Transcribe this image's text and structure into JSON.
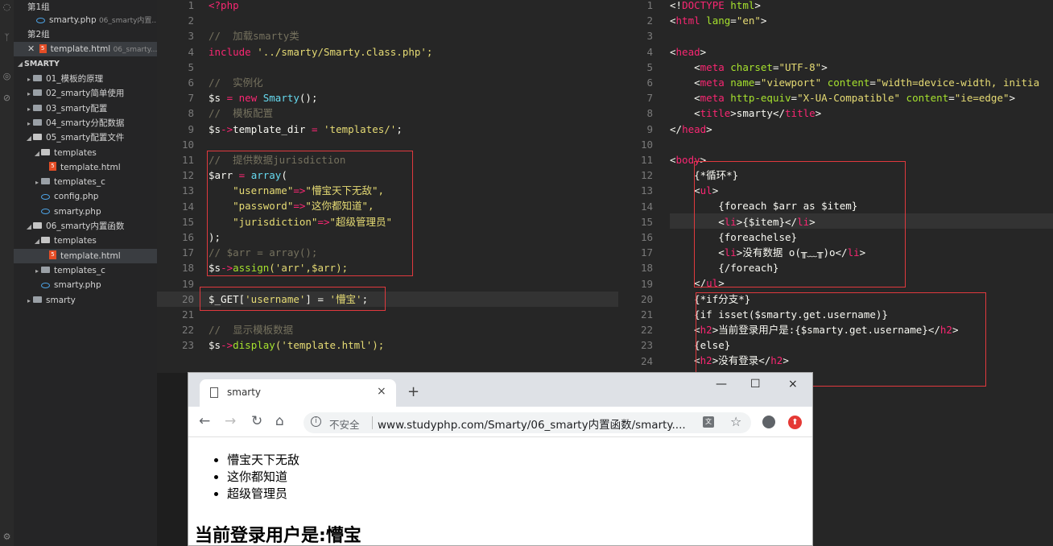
{
  "sidebar": {
    "groups": [
      {
        "label": "第1组"
      },
      {
        "label": "第2组"
      }
    ],
    "open_files": [
      {
        "name": "smarty.php",
        "path": "06_smarty内置..."
      },
      {
        "name": "template.html",
        "path": "06_smarty..."
      }
    ],
    "project": "SMARTY",
    "tree": [
      {
        "label": "01_模板的原理",
        "level": 1,
        "kind": "folder",
        "open": false
      },
      {
        "label": "02_smarty简单使用",
        "level": 1,
        "kind": "folder",
        "open": false
      },
      {
        "label": "03_smarty配置",
        "level": 1,
        "kind": "folder",
        "open": false
      },
      {
        "label": "04_smarty分配数据",
        "level": 1,
        "kind": "folder",
        "open": false
      },
      {
        "label": "05_smarty配置文件",
        "level": 1,
        "kind": "folder",
        "open": true
      },
      {
        "label": "templates",
        "level": 2,
        "kind": "folder",
        "open": true
      },
      {
        "label": "template.html",
        "level": 3,
        "kind": "html"
      },
      {
        "label": "templates_c",
        "level": 2,
        "kind": "folder",
        "open": false
      },
      {
        "label": "config.php",
        "level": 2,
        "kind": "php"
      },
      {
        "label": "smarty.php",
        "level": 2,
        "kind": "php"
      },
      {
        "label": "06_smarty内置函数",
        "level": 1,
        "kind": "folder",
        "open": true
      },
      {
        "label": "templates",
        "level": 2,
        "kind": "folder",
        "open": true
      },
      {
        "label": "template.html",
        "level": 3,
        "kind": "html",
        "selected": true
      },
      {
        "label": "templates_c",
        "level": 2,
        "kind": "folder",
        "open": false
      },
      {
        "label": "smarty.php",
        "level": 2,
        "kind": "php"
      },
      {
        "label": "smarty",
        "level": 1,
        "kind": "folder",
        "open": false
      }
    ]
  },
  "editor_left": {
    "lines": [
      [
        [
          "<?php",
          "#f92672"
        ]
      ],
      [],
      [
        [
          "//  加载smarty类",
          "#75715e"
        ]
      ],
      [
        [
          "include",
          "#f92672"
        ],
        [
          " '../smarty/Smarty.class.php';",
          "#e6db74"
        ]
      ],
      [],
      [
        [
          "//  实例化",
          "#75715e"
        ]
      ],
      [
        [
          "$s",
          "#f8f8f2"
        ],
        [
          " = ",
          "#f92672"
        ],
        [
          "new",
          "#f92672"
        ],
        [
          " Smarty",
          "#66d9ef"
        ],
        [
          "();",
          "#f8f8f2"
        ]
      ],
      [
        [
          "//  模板配置",
          "#75715e"
        ]
      ],
      [
        [
          "$s",
          "#f8f8f2"
        ],
        [
          "->",
          "#f92672"
        ],
        [
          "template_dir",
          "#f8f8f2"
        ],
        [
          " = ",
          "#f92672"
        ],
        [
          "'templates/'",
          "#e6db74"
        ],
        [
          ";",
          "#f8f8f2"
        ]
      ],
      [],
      [
        [
          "//  提供数据jurisdiction",
          "#75715e"
        ]
      ],
      [
        [
          "$arr",
          "#f8f8f2"
        ],
        [
          " = ",
          "#f92672"
        ],
        [
          "array",
          "#66d9ef"
        ],
        [
          "(",
          "#f8f8f2"
        ]
      ],
      [
        [
          "    \"username\"",
          "#e6db74"
        ],
        [
          "=>",
          "#f92672"
        ],
        [
          "\"懵宝天下无敌\",",
          "#e6db74"
        ]
      ],
      [
        [
          "    \"password\"",
          "#e6db74"
        ],
        [
          "=>",
          "#f92672"
        ],
        [
          "\"这你都知道\",",
          "#e6db74"
        ]
      ],
      [
        [
          "    \"jurisdiction\"",
          "#e6db74"
        ],
        [
          "=>",
          "#f92672"
        ],
        [
          "\"超级管理员\"",
          "#e6db74"
        ]
      ],
      [
        [
          ");",
          "#f8f8f2"
        ]
      ],
      [
        [
          "// $arr = array();",
          "#75715e"
        ]
      ],
      [
        [
          "$s",
          "#f8f8f2"
        ],
        [
          "->",
          "#f92672"
        ],
        [
          "assign",
          "#a6e22e"
        ],
        [
          "('arr',$arr);",
          "#e6db74"
        ]
      ],
      [],
      [
        [
          "$_GET[",
          "#f8f8f2"
        ],
        [
          "'username'",
          "#e6db74"
        ],
        [
          "] = ",
          "#f8f8f2"
        ],
        [
          "'懵宝'",
          "#e6db74"
        ],
        [
          ";",
          "#f8f8f2"
        ]
      ],
      [],
      [
        [
          "//  显示模板数据",
          "#75715e"
        ]
      ],
      [
        [
          "$s",
          "#f8f8f2"
        ],
        [
          "->",
          "#f92672"
        ],
        [
          "display",
          "#a6e22e"
        ],
        [
          "('template.html');",
          "#e6db74"
        ]
      ]
    ]
  },
  "editor_right": {
    "lines": [
      [
        [
          "<!",
          "#f8f8f2"
        ],
        [
          "DOCTYPE",
          "#f92672"
        ],
        [
          " html",
          "#a6e22e"
        ],
        [
          ">",
          "#f8f8f2"
        ]
      ],
      [
        [
          "<",
          "#f8f8f2"
        ],
        [
          "html",
          "#f92672"
        ],
        [
          " lang",
          "#a6e22e"
        ],
        [
          "=",
          "#f8f8f2"
        ],
        [
          "\"en\"",
          "#e6db74"
        ],
        [
          ">",
          "#f8f8f2"
        ]
      ],
      [],
      [
        [
          "<",
          "#f8f8f2"
        ],
        [
          "head",
          "#f92672"
        ],
        [
          ">",
          "#f8f8f2"
        ]
      ],
      [
        [
          "    <",
          "#f8f8f2"
        ],
        [
          "meta",
          "#f92672"
        ],
        [
          " charset",
          "#a6e22e"
        ],
        [
          "=",
          "#f8f8f2"
        ],
        [
          "\"UTF-8\"",
          "#e6db74"
        ],
        [
          ">",
          "#f8f8f2"
        ]
      ],
      [
        [
          "    <",
          "#f8f8f2"
        ],
        [
          "meta",
          "#f92672"
        ],
        [
          " name",
          "#a6e22e"
        ],
        [
          "=",
          "#f8f8f2"
        ],
        [
          "\"viewport\"",
          "#e6db74"
        ],
        [
          " content",
          "#a6e22e"
        ],
        [
          "=",
          "#f8f8f2"
        ],
        [
          "\"width=device-width, initia",
          "#e6db74"
        ]
      ],
      [
        [
          "    <",
          "#f8f8f2"
        ],
        [
          "meta",
          "#f92672"
        ],
        [
          " http-equiv",
          "#a6e22e"
        ],
        [
          "=",
          "#f8f8f2"
        ],
        [
          "\"X-UA-Compatible\"",
          "#e6db74"
        ],
        [
          " content",
          "#a6e22e"
        ],
        [
          "=",
          "#f8f8f2"
        ],
        [
          "\"ie=edge\"",
          "#e6db74"
        ],
        [
          ">",
          "#f8f8f2"
        ]
      ],
      [
        [
          "    <",
          "#f8f8f2"
        ],
        [
          "title",
          "#f92672"
        ],
        [
          ">smarty</",
          "#f8f8f2"
        ],
        [
          "title",
          "#f92672"
        ],
        [
          ">",
          "#f8f8f2"
        ]
      ],
      [
        [
          "</",
          "#f8f8f2"
        ],
        [
          "head",
          "#f92672"
        ],
        [
          ">",
          "#f8f8f2"
        ]
      ],
      [],
      [
        [
          "<",
          "#f8f8f2"
        ],
        [
          "body",
          "#f92672"
        ],
        [
          ">",
          "#f8f8f2"
        ]
      ],
      [
        [
          "    {*循环*}",
          "#f8f8f2"
        ]
      ],
      [
        [
          "    <",
          "#f8f8f2"
        ],
        [
          "ul",
          "#f92672"
        ],
        [
          ">",
          "#f8f8f2"
        ]
      ],
      [
        [
          "        {foreach $arr as $item}",
          "#f8f8f2"
        ]
      ],
      [
        [
          "        <",
          "#f8f8f2"
        ],
        [
          "li",
          "#f92672"
        ],
        [
          ">{$item}</",
          "#f8f8f2"
        ],
        [
          "li",
          "#f92672"
        ],
        [
          ">",
          "#f8f8f2"
        ]
      ],
      [
        [
          "        {foreachelse}",
          "#f8f8f2"
        ]
      ],
      [
        [
          "        <",
          "#f8f8f2"
        ],
        [
          "li",
          "#f92672"
        ],
        [
          ">没有数据 o(╥﹏╥)o</",
          "#f8f8f2"
        ],
        [
          "li",
          "#f92672"
        ],
        [
          ">",
          "#f8f8f2"
        ]
      ],
      [
        [
          "        {/foreach}",
          "#f8f8f2"
        ]
      ],
      [
        [
          "    </",
          "#f8f8f2"
        ],
        [
          "ul",
          "#f92672"
        ],
        [
          ">",
          "#f8f8f2"
        ]
      ],
      [
        [
          "    {*if分支*}",
          "#f8f8f2"
        ]
      ],
      [
        [
          "    {if isset($smarty.get.username)}",
          "#f8f8f2"
        ]
      ],
      [
        [
          "    <",
          "#f8f8f2"
        ],
        [
          "h2",
          "#f92672"
        ],
        [
          ">当前登录用户是:{$smarty.get.username}</",
          "#f8f8f2"
        ],
        [
          "h2",
          "#f92672"
        ],
        [
          ">",
          "#f8f8f2"
        ]
      ],
      [
        [
          "    {else}",
          "#f8f8f2"
        ]
      ],
      [
        [
          "    <",
          "#f8f8f2"
        ],
        [
          "h2",
          "#f92672"
        ],
        [
          ">没有登录</",
          "#f8f8f2"
        ],
        [
          "h2",
          "#f92672"
        ],
        [
          ">",
          "#f8f8f2"
        ]
      ]
    ]
  },
  "browser": {
    "tab_title": "smarty",
    "security_label": "不安全",
    "url": "www.studyphp.com/Smarty/06_smarty内置函数/smarty....",
    "list_items": [
      "懵宝天下无敌",
      "这你都知道",
      "超级管理员"
    ],
    "heading": "当前登录用户是:懵宝"
  },
  "icons": {
    "close": "×",
    "new_tab": "+",
    "minimize": "—",
    "maximize": "☐",
    "back": "←",
    "forward": "→",
    "reload": "↻",
    "home": "⌂",
    "star": "☆"
  },
  "colors": {
    "accent_box": "#e0393e",
    "editor_bg": "#262626"
  }
}
